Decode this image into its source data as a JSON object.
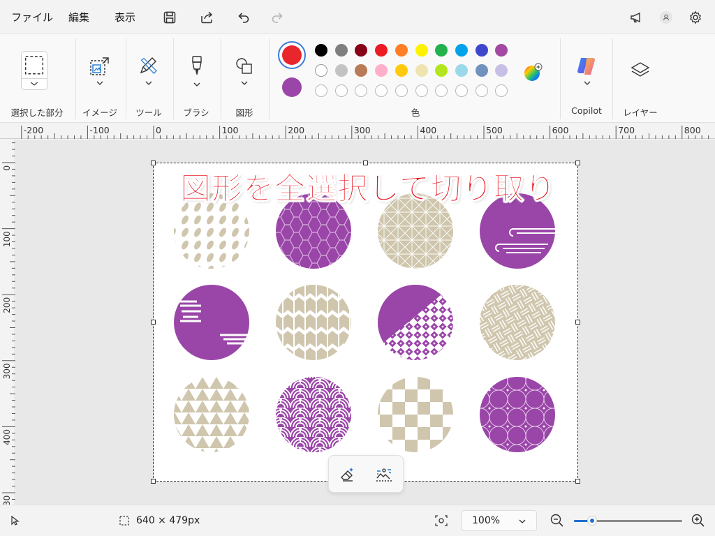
{
  "menu": {
    "file": "ファイル",
    "edit": "編集",
    "view": "表示"
  },
  "ribbon": {
    "groups": {
      "selection": "選択した部分",
      "image": "イメージ",
      "tools": "ツール",
      "brush": "ブラシ",
      "shapes": "図形",
      "colors": "色",
      "copilot": "Copilot",
      "layers": "レイヤー"
    },
    "primary_color": "#e8262c",
    "secondary_color": "#9a45a8",
    "palette_row1": [
      "#000000",
      "#7f7f7f",
      "#880015",
      "#ed1c24",
      "#ff7f27",
      "#fff200",
      "#22b14c",
      "#00a2e8",
      "#3f48cc",
      "#a349a4"
    ],
    "palette_row2": [
      "#ffffff",
      "#c3c3c3",
      "#b97a57",
      "#ffaec9",
      "#ffc90e",
      "#efe4b0",
      "#b5e61d",
      "#99d9ea",
      "#7092be",
      "#c8bfe7"
    ]
  },
  "ruler": {
    "top_labels": [
      "-200",
      "-100",
      "0",
      "100",
      "200",
      "300",
      "400",
      "500",
      "600",
      "700",
      "800"
    ],
    "left_labels": [
      "0",
      "100",
      "200",
      "300",
      "400",
      "30"
    ]
  },
  "canvas": {
    "banner": "図形を全選択して切り取り",
    "pattern_colors": {
      "beige": "#cfc6ad",
      "purple": "#9a45a8"
    }
  },
  "status": {
    "selection_size": "640 × 479px",
    "zoom": "100%",
    "zoom_fraction": 0.17
  }
}
